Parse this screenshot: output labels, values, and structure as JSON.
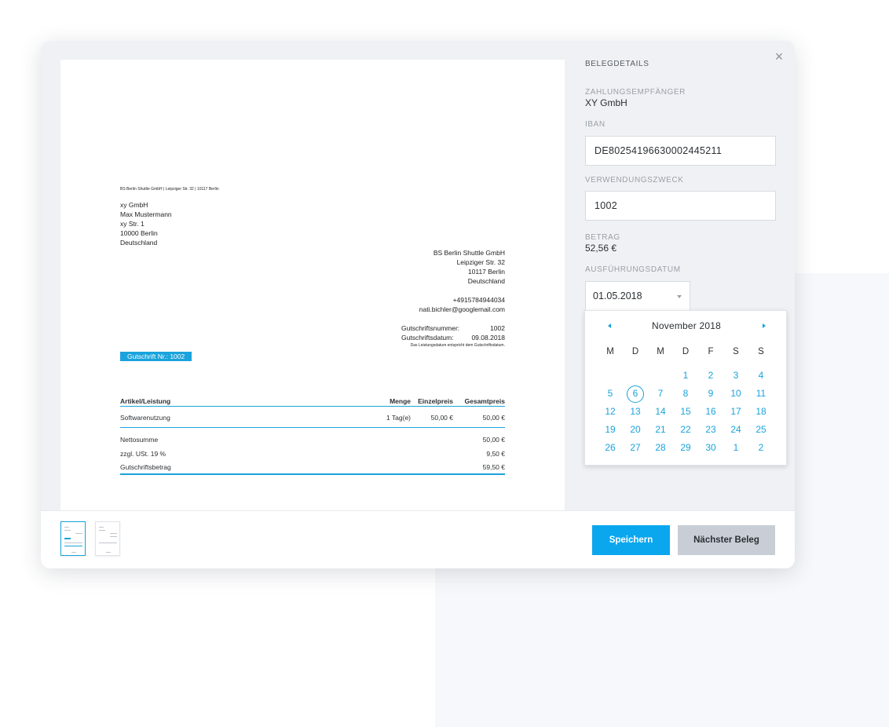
{
  "document": {
    "sender_line": "BS Berlin Shuttle GmbH | Leipziger Str. 32 | 10117 Berlin",
    "recipient": [
      "xy GmbH",
      "Max Mustermann",
      "xy Str. 1",
      "10000 Berlin",
      "Deutschland"
    ],
    "company": [
      "BS Berlin Shuttle GmbH",
      "Leipziger Str. 32",
      "10117 Berlin",
      "Deutschland"
    ],
    "contact": [
      "+4915784944034",
      "nati.bichler@googlemail.com"
    ],
    "meta": {
      "number_label": "Gutschriftsnummer:",
      "number_value": "1002",
      "date_label": "Gutschriftsdatum:",
      "date_value": "09.08.2018",
      "note": "Das Leistungsdatum entspricht dem Gutschriftsdatum."
    },
    "badge": "Gutschrift Nr.: 1002",
    "table": {
      "headers": [
        "Artikel/Leistung",
        "Menge",
        "Einzelpreis",
        "Gesamtpreis"
      ],
      "rows": [
        [
          "Softwarenutzung",
          "1 Tag(e)",
          "50,00 €",
          "50,00 €"
        ]
      ],
      "totals": [
        {
          "label": "Nettosumme",
          "value": "50,00 €"
        },
        {
          "label": "zzgl. USt. 19 %",
          "value": "9,50 €"
        },
        {
          "label": "Gutschriftsbetrag",
          "value": "59,50 €"
        }
      ]
    }
  },
  "details": {
    "heading": "BELEGDETAILS",
    "payee_label": "ZAHLUNGSEMPFÄNGER",
    "payee_value": "XY GmbH",
    "iban_label": "IBAN",
    "iban_value": "DE80254196630002445211",
    "purpose_label": "VERWENDUNGSZWECK",
    "purpose_value": "1002",
    "amount_label": "BETRAG",
    "amount_value": "52,56 €",
    "date_label": "AUSFÜHRUNGSDATUM",
    "date_value": "01.05.2018"
  },
  "calendar": {
    "title": "November 2018",
    "weekdays": [
      "M",
      "D",
      "M",
      "D",
      "F",
      "S",
      "S"
    ],
    "days": [
      "",
      "",
      "",
      "1",
      "2",
      "3",
      "4",
      "5",
      "6",
      "7",
      "8",
      "9",
      "10",
      "11",
      "12",
      "13",
      "14",
      "15",
      "16",
      "17",
      "18",
      "19",
      "20",
      "21",
      "22",
      "23",
      "24",
      "25",
      "26",
      "27",
      "28",
      "29",
      "30",
      "1",
      "2"
    ],
    "selected_day": "6"
  },
  "footer": {
    "save_label": "Speichern",
    "next_label": "Nächster Beleg"
  },
  "colors": {
    "accent": "#1aa3dc",
    "save_button": "#0aa7ef",
    "secondary_button": "#c9ced6"
  },
  "icons": {
    "close": "close-icon",
    "dropdown": "chevron-down-icon",
    "prev": "chevron-left-icon",
    "next": "chevron-right-icon"
  }
}
